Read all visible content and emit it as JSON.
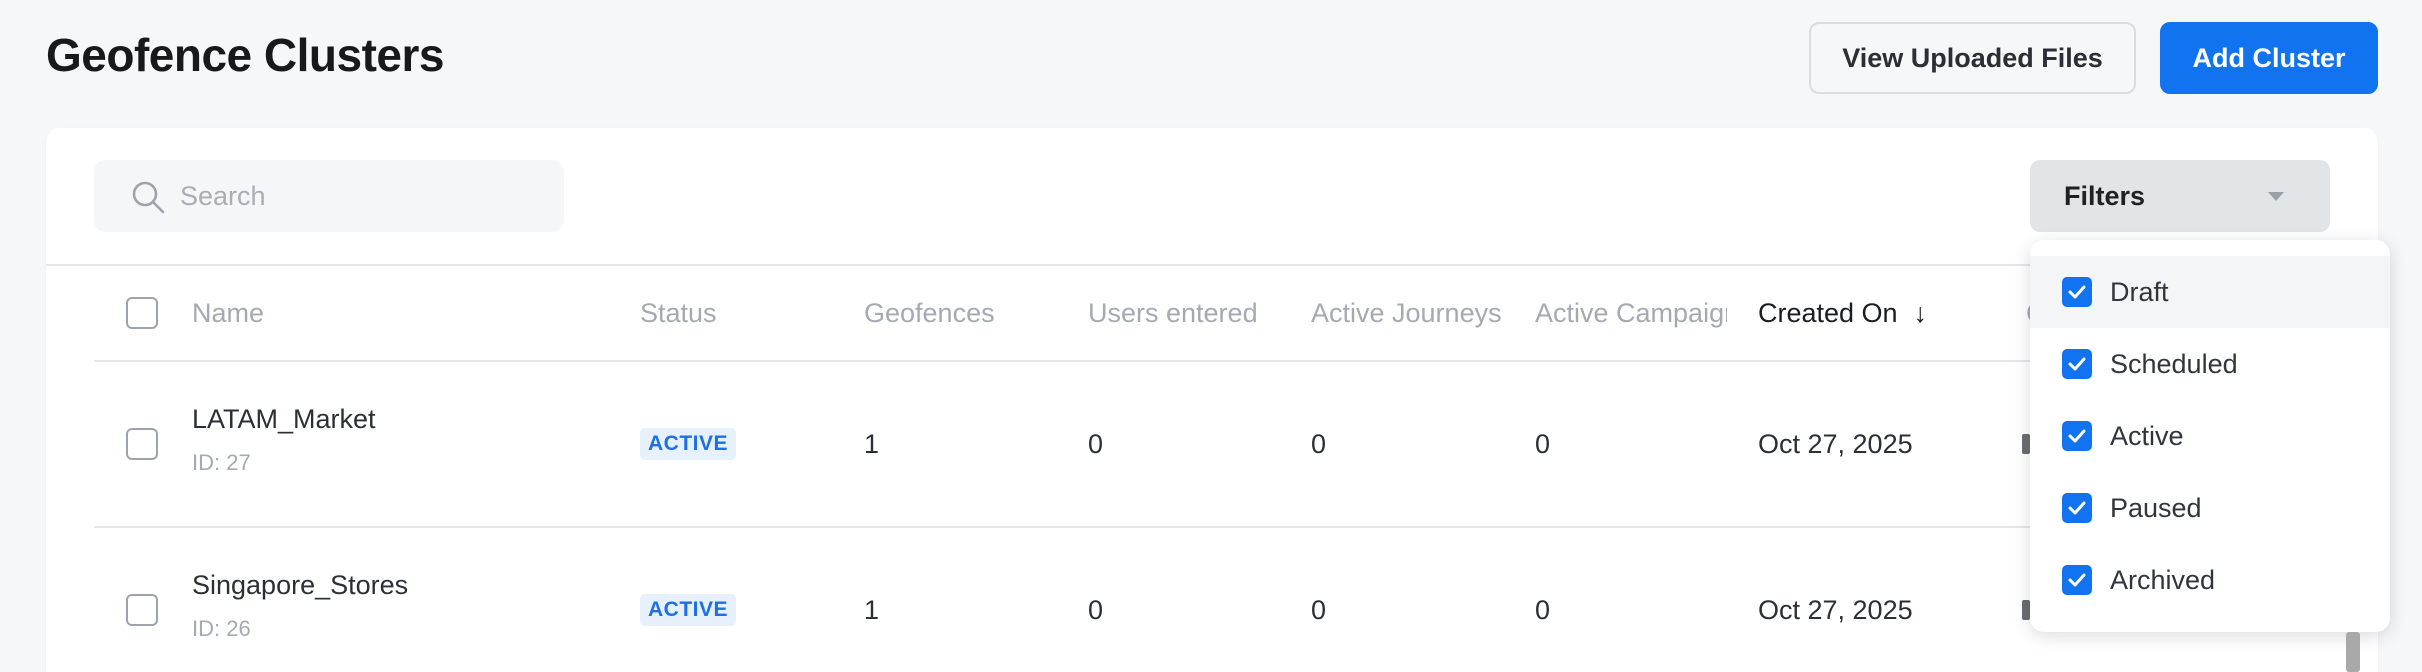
{
  "header": {
    "title": "Geofence Clusters",
    "view_files_label": "View Uploaded Files",
    "add_cluster_label": "Add Cluster"
  },
  "search": {
    "placeholder": "Search"
  },
  "filters": {
    "label": "Filters",
    "options": [
      {
        "label": "Draft",
        "checked": true
      },
      {
        "label": "Scheduled",
        "checked": true
      },
      {
        "label": "Active",
        "checked": true
      },
      {
        "label": "Paused",
        "checked": true
      },
      {
        "label": "Archived",
        "checked": true
      }
    ]
  },
  "table": {
    "columns": [
      "Name",
      "Status",
      "Geofences",
      "Users entered",
      "Active Journeys",
      "Active Campaigns",
      "Created On",
      "C"
    ],
    "sort_arrow": "↓",
    "rows": [
      {
        "name": "LATAM_Market",
        "id": "ID: 27",
        "status": "ACTIVE",
        "geofences": "1",
        "users_entered": "0",
        "active_journeys": "0",
        "active_campaigns": "0",
        "created_on": "Oct 27, 2025"
      },
      {
        "name": "Singapore_Stores",
        "id": "ID: 26",
        "status": "ACTIVE",
        "geofences": "1",
        "users_entered": "0",
        "active_journeys": "0",
        "active_campaigns": "0",
        "created_on": "Oct 27, 2025"
      }
    ]
  },
  "colors": {
    "primary": "#1273f0",
    "badge_text": "#1f6fe3",
    "badge_bg": "#e7f0fd"
  },
  "icons": {
    "search": "search-icon",
    "check": "check-icon",
    "caret": "chevron-down-icon"
  }
}
